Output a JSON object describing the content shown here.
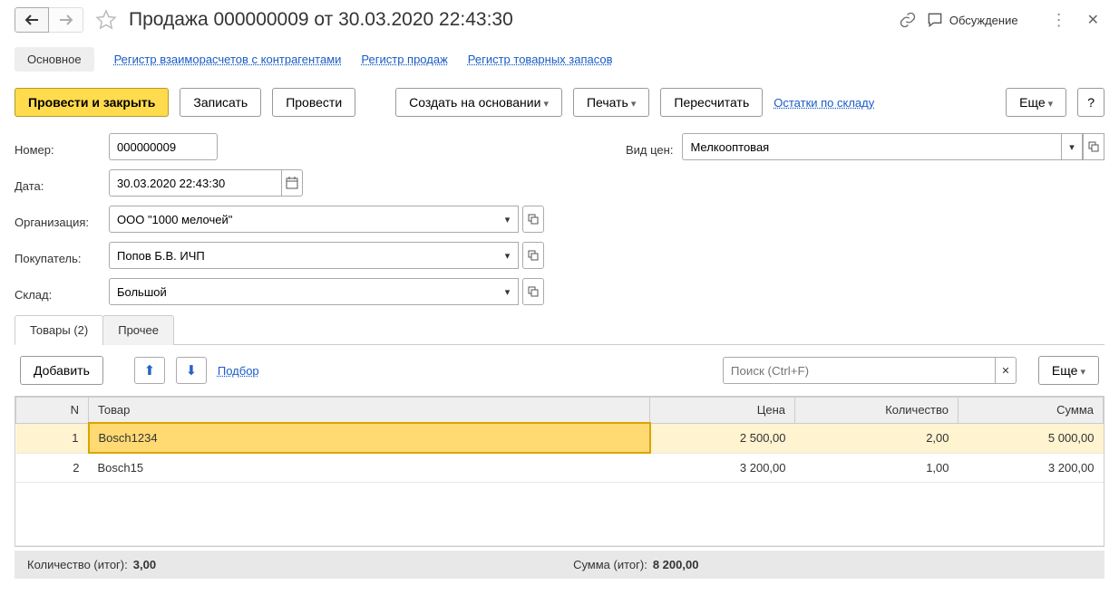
{
  "header": {
    "title": "Продажа 000000009 от 30.03.2020 22:43:30",
    "discuss_label": "Обсуждение"
  },
  "nav": {
    "main": "Основное",
    "links": [
      "Регистр взаиморасчетов с контрагентами",
      "Регистр продаж",
      "Регистр товарных запасов"
    ]
  },
  "toolbar": {
    "post_close": "Провести и закрыть",
    "save": "Записать",
    "post": "Провести",
    "create_based": "Создать на основании",
    "print": "Печать",
    "recalc": "Пересчитать",
    "stock_link": "Остатки по складу",
    "more": "Еще",
    "help": "?"
  },
  "fields": {
    "number_label": "Номер:",
    "number": "000000009",
    "date_label": "Дата:",
    "date": "30.03.2020 22:43:30",
    "org_label": "Организация:",
    "org": "ООО \"1000 мелочей\"",
    "customer_label": "Покупатель:",
    "customer": "Попов Б.В. ИЧП",
    "warehouse_label": "Склад:",
    "warehouse": "Большой",
    "price_type_label": "Вид цен:",
    "price_type": "Мелкооптовая"
  },
  "tabs": {
    "goods": "Товары (2)",
    "other": "Прочее"
  },
  "tablebar": {
    "add": "Добавить",
    "pick": "Подбор",
    "search_placeholder": "Поиск (Ctrl+F)",
    "more": "Еще"
  },
  "table": {
    "headers": {
      "n": "N",
      "item": "Товар",
      "price": "Цена",
      "qty": "Количество",
      "sum": "Сумма"
    },
    "rows": [
      {
        "n": "1",
        "item": "Bosch1234",
        "price": "2 500,00",
        "qty": "2,00",
        "sum": "5 000,00"
      },
      {
        "n": "2",
        "item": "Bosch15",
        "price": "3 200,00",
        "qty": "1,00",
        "sum": "3 200,00"
      }
    ]
  },
  "totals": {
    "qty_label": "Количество (итог):",
    "qty": "3,00",
    "sum_label": "Сумма (итог):",
    "sum": "8 200,00"
  }
}
